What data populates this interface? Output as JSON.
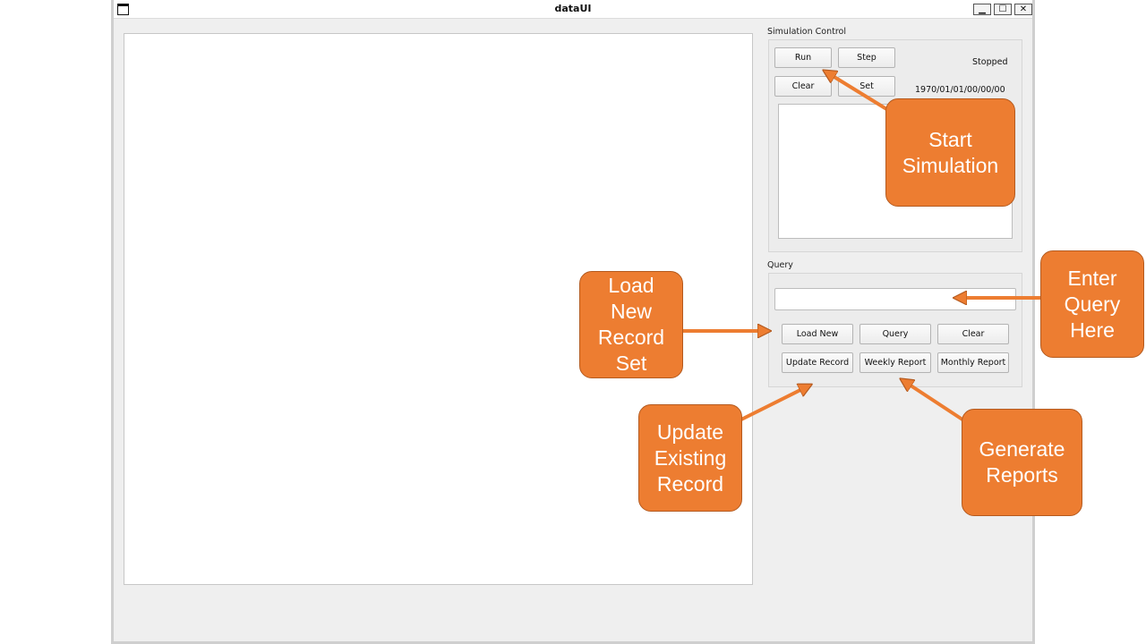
{
  "window": {
    "title": "dataUI",
    "controls": {
      "minimize": "▁",
      "maximize": "☐",
      "close": "✕"
    }
  },
  "simulation_control": {
    "label": "Simulation Control",
    "buttons": {
      "run": "Run",
      "step": "Step",
      "clear": "Clear",
      "set": "Set"
    },
    "status": "Stopped",
    "timestamp": "1970/01/01/00/00/00"
  },
  "query": {
    "label": "Query",
    "input_value": "",
    "buttons": {
      "load_new": "Load New",
      "query": "Query",
      "clear": "Clear",
      "update_record": "Update Record",
      "weekly_report": "Weekly Report",
      "monthly_report": "Monthly Report"
    }
  },
  "callouts": {
    "start_simulation": "Start\nSimulation",
    "enter_query": "Enter\nQuery\nHere",
    "load_new_record_set": "Load\nNew\nRecord\nSet",
    "update_existing_record": "Update\nExisting\nRecord",
    "generate_reports": "Generate\nReports"
  },
  "colors": {
    "callout": "#ed7d31",
    "window_bg": "#efefef"
  }
}
